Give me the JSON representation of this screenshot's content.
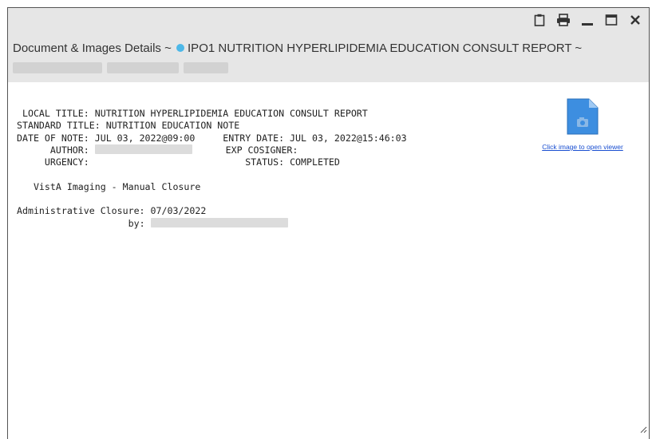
{
  "window": {
    "title_prefix": "Document & Images Details ~",
    "title_main": "IPO1 NUTRITION HYPERLIPIDEMIA EDUCATION CONSULT REPORT ~",
    "status_dot_color": "#4db8e8"
  },
  "toolbar": {
    "icons": [
      "clipboard-icon",
      "print-icon",
      "minimize-icon",
      "maximize-icon",
      "close-icon"
    ]
  },
  "note": {
    "local_title_label": " LOCAL TITLE:",
    "local_title": "NUTRITION HYPERLIPIDEMIA EDUCATION CONSULT REPORT",
    "standard_title_label": "STANDARD TITLE:",
    "standard_title": "NUTRITION EDUCATION NOTE",
    "date_of_note_label": "DATE OF NOTE:",
    "date_of_note": "JUL 03, 2022@09:00",
    "entry_date_label": "ENTRY DATE:",
    "entry_date": "JUL 03, 2022@15:46:03",
    "author_label": "AUTHOR:",
    "exp_cosigner_label": "EXP COSIGNER:",
    "urgency_label": "URGENCY:",
    "status_label": "STATUS:",
    "status": "COMPLETED",
    "imaging_line": "VistA Imaging - Manual Closure",
    "admin_closure_label": "Administrative Closure:",
    "admin_closure_date": "07/03/2022",
    "by_label": "by:"
  },
  "viewer": {
    "link_text": "Click image to open viewer"
  },
  "colors": {
    "header_bg": "#e6e6e6",
    "link": "#1a4fd1",
    "doc_icon": "#3d8ee0"
  }
}
